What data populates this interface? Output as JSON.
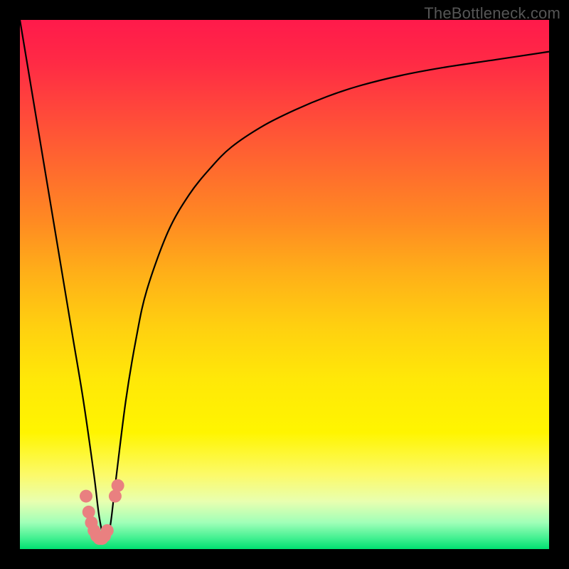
{
  "watermark": "TheBottleneck.com",
  "colors": {
    "frame": "#000000",
    "curve": "#000000",
    "dots": "#e98080",
    "gradient_top": "#ff1a4b",
    "gradient_bottom": "#00e070"
  },
  "chart_data": {
    "type": "line",
    "title": "",
    "xlabel": "",
    "ylabel": "",
    "xlim": [
      0,
      100
    ],
    "ylim": [
      0,
      100
    ],
    "x": [
      0,
      2,
      4,
      6,
      8,
      10,
      12,
      14,
      15,
      16,
      17,
      18,
      20,
      22,
      24,
      28,
      32,
      36,
      40,
      46,
      52,
      58,
      64,
      72,
      80,
      90,
      100
    ],
    "y": [
      100,
      88,
      76,
      64,
      52,
      40,
      28,
      14,
      6,
      2,
      4,
      12,
      28,
      40,
      49,
      60,
      67,
      72,
      76,
      80,
      83,
      85.5,
      87.5,
      89.5,
      91,
      92.5,
      94
    ],
    "series": [
      {
        "name": "bottleneck-curve",
        "x": [
          0,
          2,
          4,
          6,
          8,
          10,
          12,
          14,
          15,
          16,
          17,
          18,
          20,
          22,
          24,
          28,
          32,
          36,
          40,
          46,
          52,
          58,
          64,
          72,
          80,
          90,
          100
        ],
        "y": [
          100,
          88,
          76,
          64,
          52,
          40,
          28,
          14,
          6,
          2,
          4,
          12,
          28,
          40,
          49,
          60,
          67,
          72,
          76,
          80,
          83,
          85.5,
          87.5,
          89.5,
          91,
          92.5,
          94
        ]
      }
    ],
    "markers": [
      {
        "x": 12.5,
        "y": 10
      },
      {
        "x": 13.0,
        "y": 7
      },
      {
        "x": 13.5,
        "y": 5
      },
      {
        "x": 14.0,
        "y": 3.5
      },
      {
        "x": 14.5,
        "y": 2.5
      },
      {
        "x": 15.0,
        "y": 2
      },
      {
        "x": 15.5,
        "y": 2
      },
      {
        "x": 16.0,
        "y": 2.5
      },
      {
        "x": 16.5,
        "y": 3.5
      },
      {
        "x": 18.0,
        "y": 10
      },
      {
        "x": 18.5,
        "y": 12
      }
    ],
    "minimum": {
      "x": 15.2,
      "y": 1.8
    }
  }
}
